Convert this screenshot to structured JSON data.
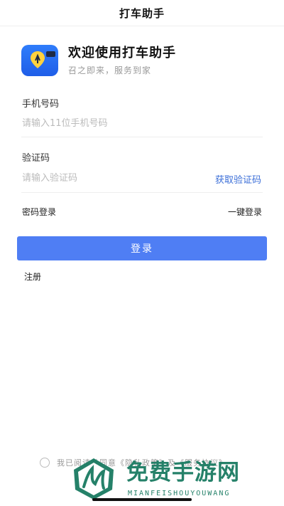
{
  "nav": {
    "title": "打车助手"
  },
  "brand": {
    "title": "欢迎使用打车助手",
    "subtitle": "召之即来，服务到家",
    "icon": "app-logo-icon"
  },
  "form": {
    "phone_label": "手机号码",
    "phone_placeholder": "请输入11位手机号码",
    "phone_value": "",
    "code_label": "验证码",
    "code_placeholder": "请输入验证码",
    "code_value": "",
    "get_code_label": "获取验证码"
  },
  "links": {
    "password_login": "密码登录",
    "one_tap_login": "一键登录",
    "register": "注册"
  },
  "login_button": {
    "label": "登录"
  },
  "agreement": {
    "text": "我已阅读并同意《隐私政策》及《服务协议》"
  },
  "watermark": {
    "title": "免费手游网",
    "subtitle": "MIANFEISHOUYOUWANG"
  },
  "colors": {
    "primary_button": "#4f7ef4",
    "link": "#3c6fd8",
    "watermark": "#1a7b62",
    "app_icon": "#2f7dfb"
  }
}
